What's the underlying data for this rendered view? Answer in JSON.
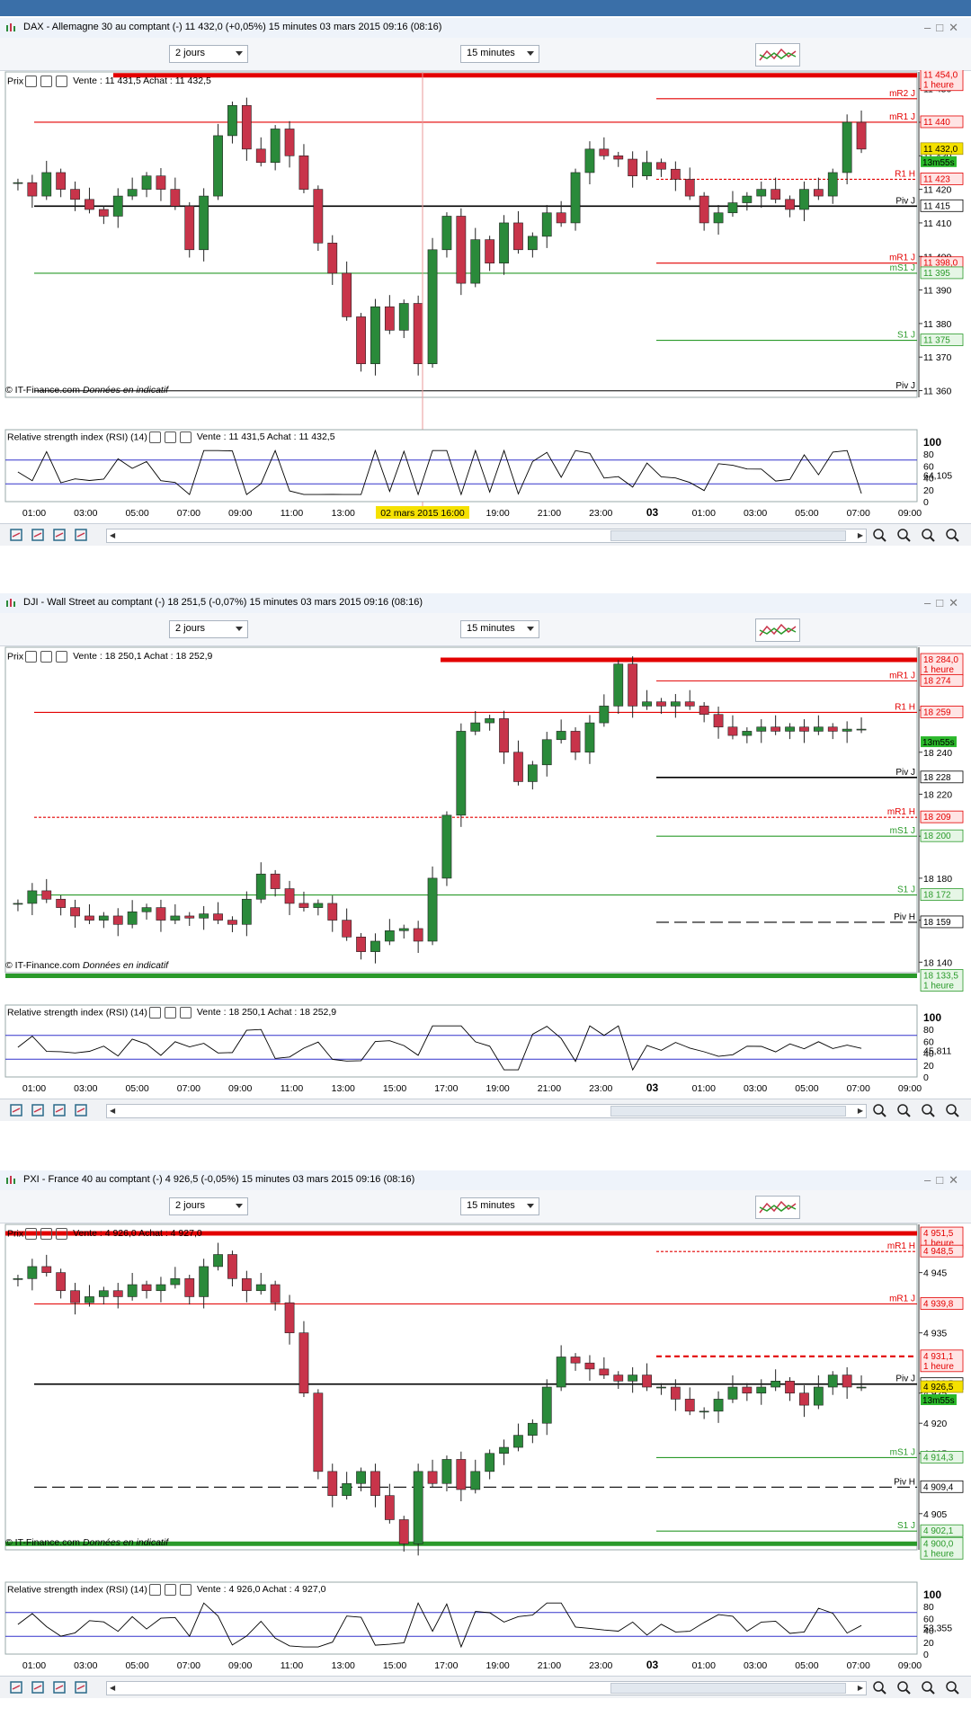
{
  "colors": {
    "resistance": "#e30000",
    "support": "#2a9a2a",
    "pivot": "#000000",
    "rsi_line": "#000000",
    "rsi_band": "#3333cc",
    "candle_up": "#2a8a3a",
    "candle_down": "#c8344a",
    "price_bg": "#f5e100",
    "timer_bg": "#2bb82b"
  },
  "panels": [
    {
      "id": "dax",
      "title": "DAX - Allemagne 30 au comptant (-)     11 432,0 (+0,05%)     15 minutes   03 mars 2015 09:16 (08:16)",
      "period_select": "2 jours",
      "interval_select": "15 minutes",
      "price_legend_label": "Prix",
      "price_legend_quote": "Vente : 11 431,5 Achat : 11 432,5",
      "copyright": "© IT-Finance.com",
      "disclaimer": "Données en indicatif",
      "rsi_legend": "Relative strength index (RSI) (14)",
      "rsi_quote": "Vente : 11 431,5 Achat : 11 432,5",
      "rsi_value": "64,105",
      "cursor_time": "02 mars 2015 16:00"
    },
    {
      "id": "dji",
      "title": "DJI - Wall Street au comptant (-)     18 251,5 (-0,07%)     15 minutes   03 mars 2015 09:16 (08:16)",
      "period_select": "2 jours",
      "interval_select": "15 minutes",
      "price_legend_label": "Prix",
      "price_legend_quote": "Vente : 18 250,1 Achat : 18 252,9",
      "copyright": "© IT-Finance.com",
      "disclaimer": "Données en indicatif",
      "rsi_legend": "Relative strength index (RSI) (14)",
      "rsi_quote": "Vente : 18 250,1 Achat : 18 252,9",
      "rsi_value": "45,811",
      "cursor_time": ""
    },
    {
      "id": "pxi",
      "title": "PXI - France 40 au comptant (-)     4 926,5 (-0,05%)     15 minutes   03 mars 2015 09:16 (08:16)",
      "period_select": "2 jours",
      "interval_select": "15 minutes",
      "price_legend_label": "Prix",
      "price_legend_quote": "Vente : 4 926,0 Achat : 4 927,0",
      "copyright": "© IT-Finance.com",
      "disclaimer": "Données en indicatif",
      "rsi_legend": "Relative strength index (RSI) (14)",
      "rsi_quote": "Vente : 4 926,0 Achat : 4 927,0",
      "rsi_value": "53,355",
      "cursor_time": ""
    }
  ],
  "chart_data": [
    {
      "type": "candlestick",
      "title": "DAX - Allemagne 30 au comptant (-)",
      "xlabel": "",
      "ylabel": "",
      "x_ticks": [
        "01:00",
        "03:00",
        "05:00",
        "07:00",
        "09:00",
        "11:00",
        "13:00",
        "15:00",
        "17:00",
        "19:00",
        "21:00",
        "23:00",
        "03",
        "01:00",
        "03:00",
        "05:00",
        "07:00",
        "09:00"
      ],
      "y_ticks": [
        "11 450",
        "11 440",
        "11 430",
        "11 420",
        "11 410",
        "11 400",
        "11 390",
        "11 380",
        "11 370",
        "11 360"
      ],
      "ylim": [
        11358,
        11455
      ],
      "close_path": [
        11422,
        11418,
        11425,
        11420,
        11417,
        11414,
        11412,
        11418,
        11420,
        11424,
        11420,
        11415,
        11402,
        11418,
        11436,
        11445,
        11432,
        11428,
        11438,
        11430,
        11420,
        11404,
        11395,
        11382,
        11368,
        11385,
        11378,
        11386,
        11368,
        11402,
        11412,
        11392,
        11405,
        11398,
        11410,
        11402,
        11406,
        11413,
        11410,
        11425,
        11432,
        11430,
        11429,
        11424,
        11428,
        11426,
        11423,
        11418,
        11410,
        11413,
        11416,
        11418,
        11420,
        11417,
        11414,
        11420,
        11418,
        11425,
        11440,
        11432
      ],
      "levels": [
        {
          "label": "",
          "value": "11 454,0",
          "sub": "1 heure",
          "kind": "resistance",
          "style": "thick"
        },
        {
          "label": "mR2 J",
          "value": "",
          "kind": "resistance",
          "style": "thin"
        },
        {
          "label": "mR1 J",
          "value": "11 440",
          "kind": "resistance",
          "style": "thin"
        },
        {
          "label": "R1 H",
          "value": "11 423",
          "kind": "resistance",
          "style": "dashed"
        },
        {
          "label": "Piv J",
          "value": "11 415",
          "kind": "pivot",
          "style": "thick"
        },
        {
          "label": "mR1 J",
          "value": "11 398,0",
          "kind": "resistance",
          "style": "thin"
        },
        {
          "label": "mS1 J",
          "value": "11 395",
          "kind": "support",
          "style": "thin"
        },
        {
          "label": "S1 J",
          "value": "11 375",
          "kind": "support",
          "style": "thin"
        },
        {
          "label": "Piv J",
          "value": "",
          "kind": "pivot",
          "style": "thin"
        }
      ],
      "last_price": "11 432,0",
      "timer": "13m55s",
      "rsi": {
        "period": 14,
        "ylim": [
          0,
          100
        ],
        "y_ticks": [
          "100",
          "80",
          "60",
          "40",
          "20",
          "0"
        ],
        "bands": [
          70,
          30
        ],
        "last": "64,105"
      }
    },
    {
      "type": "candlestick",
      "title": "DJI - Wall Street au comptant (-)",
      "xlabel": "",
      "ylabel": "",
      "x_ticks": [
        "01:00",
        "03:00",
        "05:00",
        "07:00",
        "09:00",
        "11:00",
        "13:00",
        "15:00",
        "17:00",
        "19:00",
        "21:00",
        "23:00",
        "03",
        "01:00",
        "03:00",
        "05:00",
        "07:00",
        "09:00"
      ],
      "y_ticks": [
        "18 260",
        "18 240",
        "18 220",
        "18 200",
        "18 180",
        "18 160",
        "18 140"
      ],
      "ylim": [
        18135,
        18290
      ],
      "close_path": [
        18168,
        18174,
        18170,
        18166,
        18162,
        18160,
        18162,
        18158,
        18164,
        18166,
        18160,
        18162,
        18161,
        18163,
        18160,
        18158,
        18170,
        18182,
        18175,
        18168,
        18166,
        18168,
        18160,
        18152,
        18145,
        18150,
        18155,
        18156,
        18150,
        18180,
        18210,
        18250,
        18254,
        18256,
        18240,
        18226,
        18234,
        18246,
        18250,
        18240,
        18254,
        18262,
        18282,
        18262,
        18264,
        18262,
        18264,
        18262,
        18258,
        18252,
        18248,
        18250,
        18252,
        18250,
        18252,
        18250,
        18252,
        18250,
        18251,
        18251
      ],
      "levels": [
        {
          "label": "",
          "value": "18 284,0",
          "sub": "1 heure",
          "kind": "resistance",
          "style": "thick"
        },
        {
          "label": "mR1 J",
          "value": "18 274",
          "kind": "resistance",
          "style": "thin"
        },
        {
          "label": "R1 H",
          "value": "18 259",
          "kind": "resistance",
          "style": "thin"
        },
        {
          "label": "Piv J",
          "value": "18 228",
          "kind": "pivot",
          "style": "thick"
        },
        {
          "label": "mR1 H",
          "value": "18 209",
          "kind": "resistance",
          "style": "dashed"
        },
        {
          "label": "mS1 J",
          "value": "18 200",
          "kind": "support",
          "style": "thin"
        },
        {
          "label": "S1 J",
          "value": "18 172",
          "kind": "support",
          "style": "thin"
        },
        {
          "label": "Piv H",
          "value": "18 159",
          "kind": "pivot",
          "style": "longdash"
        },
        {
          "label": "",
          "value": "18 133,5",
          "sub": "1 heure",
          "kind": "support",
          "style": "thick"
        }
      ],
      "last_price": "",
      "timer": "13m55s",
      "rsi": {
        "period": 14,
        "ylim": [
          0,
          100
        ],
        "y_ticks": [
          "100",
          "80",
          "60",
          "40",
          "20",
          "0"
        ],
        "bands": [
          70,
          30
        ],
        "last": "45,811"
      }
    },
    {
      "type": "candlestick",
      "title": "PXI - France 40 au comptant (-)",
      "xlabel": "",
      "ylabel": "",
      "x_ticks": [
        "01:00",
        "03:00",
        "05:00",
        "07:00",
        "09:00",
        "11:00",
        "13:00",
        "15:00",
        "17:00",
        "19:00",
        "21:00",
        "23:00",
        "03",
        "01:00",
        "03:00",
        "05:00",
        "07:00",
        "09:00"
      ],
      "y_ticks": [
        "4 945",
        "4 935",
        "4 925",
        "4 920",
        "4 915",
        "4 905"
      ],
      "ylim": [
        4899,
        4953
      ],
      "close_path": [
        4944,
        4946,
        4945,
        4942,
        4940,
        4941,
        4942,
        4941,
        4943,
        4942,
        4943,
        4944,
        4941,
        4946,
        4948,
        4944,
        4942,
        4943,
        4940,
        4935,
        4925,
        4912,
        4908,
        4910,
        4912,
        4908,
        4904,
        4900,
        4912,
        4910,
        4914,
        4909,
        4912,
        4915,
        4916,
        4918,
        4920,
        4926,
        4931,
        4930,
        4929,
        4928,
        4927,
        4928,
        4926,
        4926,
        4924,
        4922,
        4922,
        4924,
        4926,
        4925,
        4926,
        4927,
        4925,
        4923,
        4926,
        4928,
        4926,
        4926
      ],
      "levels": [
        {
          "label": "",
          "value": "4 951,5",
          "sub": "1 heure",
          "kind": "resistance",
          "style": "thick"
        },
        {
          "label": "mR1 H",
          "value": "4 948,5",
          "kind": "resistance",
          "style": "dashed"
        },
        {
          "label": "mR1 J",
          "value": "4 939,8",
          "kind": "resistance",
          "style": "thin"
        },
        {
          "label": "",
          "value": "4 931,1",
          "sub": "1 heure",
          "kind": "resistance",
          "style": "dashedthick"
        },
        {
          "label": "Piv J",
          "value": "4 926,5",
          "kind": "pivot",
          "style": "thick"
        },
        {
          "label": "mS1 J",
          "value": "4 914,3",
          "kind": "support",
          "style": "thin"
        },
        {
          "label": "Piv H",
          "value": "4 909,4",
          "kind": "pivot",
          "style": "longdash"
        },
        {
          "label": "S1 J",
          "value": "4 902,1",
          "kind": "support",
          "style": "thin"
        },
        {
          "label": "",
          "value": "4 900,0",
          "sub": "1 heure",
          "kind": "support",
          "style": "thick"
        }
      ],
      "last_price": "4 926,5",
      "timer": "13m55s",
      "rsi": {
        "period": 14,
        "ylim": [
          0,
          100
        ],
        "y_ticks": [
          "100",
          "80",
          "60",
          "40",
          "20",
          "0"
        ],
        "bands": [
          70,
          30
        ],
        "last": "53,355"
      }
    }
  ]
}
